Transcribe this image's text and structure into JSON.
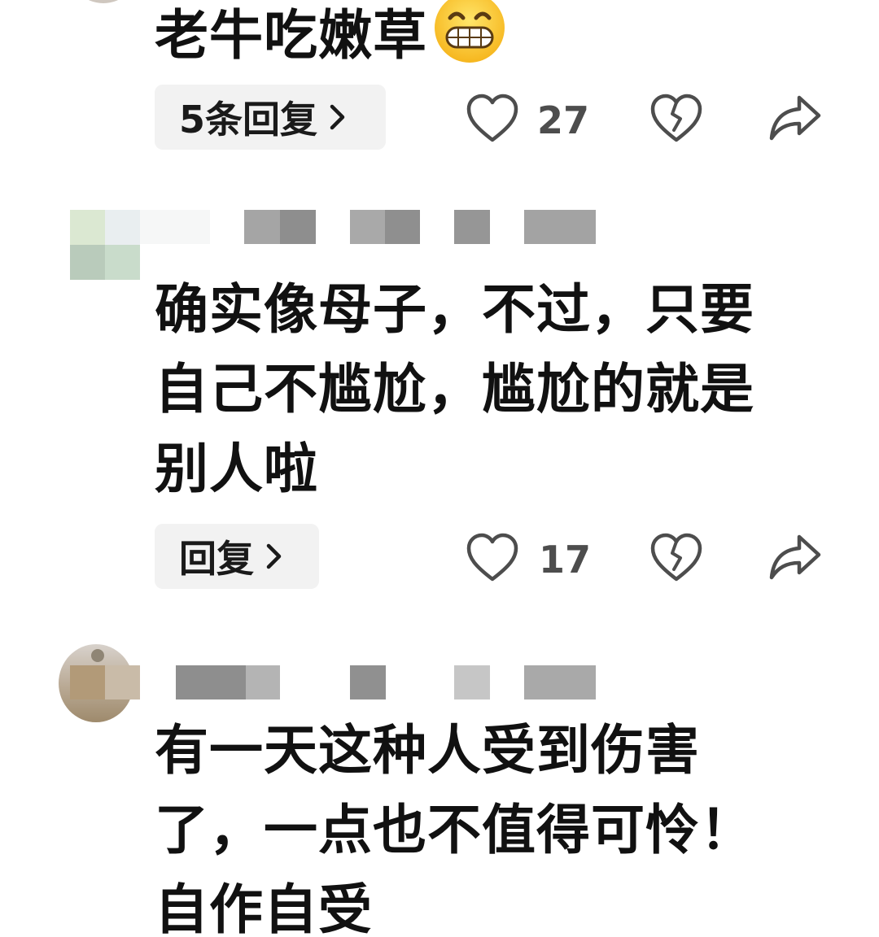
{
  "comments": [
    {
      "text": "老牛吃嫩草",
      "emoji": "grinning-face-emoji",
      "reply_label": "5条回复",
      "like_count": "27"
    },
    {
      "text": "确实像母子，不过，只要\n自己不尴尬，尴尬的就是\n别人啦",
      "reply_label": "回复",
      "like_count": "17"
    },
    {
      "text": "有一天这种人受到伤害\n了，一点也不值得可怜！\n自作自受"
    }
  ],
  "icons": {
    "like": "heart-outline-icon",
    "dislike": "broken-heart-icon",
    "share": "share-arrow-icon",
    "chevron": "chevron-right-icon"
  },
  "colors": {
    "pill_background": "#f2f2f2",
    "icon_gray": "#4d4d4d",
    "text": "#111111"
  }
}
